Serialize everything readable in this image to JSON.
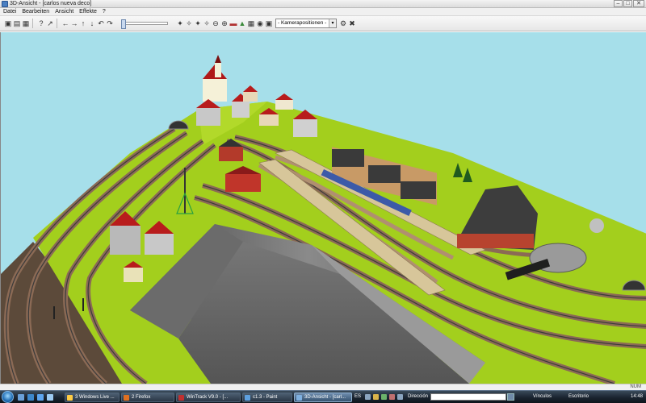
{
  "window": {
    "title": "3D-Ansicht - [carlos nueva deco]",
    "buttons": {
      "minimize": "–",
      "maximize": "□",
      "close": "✕"
    }
  },
  "menu": [
    "Datei",
    "Bearbeiten",
    "Ansicht",
    "Effekte",
    "?"
  ],
  "toolbar": {
    "icons": [
      {
        "name": "save-icon",
        "glyph": "▣"
      },
      {
        "name": "open-icon",
        "glyph": "▤"
      },
      {
        "name": "print-icon",
        "glyph": "▦"
      },
      {
        "name": "help-icon",
        "glyph": "?"
      },
      {
        "name": "context-help-icon",
        "glyph": "↗"
      },
      {
        "name": "arrow-left-icon",
        "glyph": "←"
      },
      {
        "name": "arrow-right-icon",
        "glyph": "→"
      },
      {
        "name": "arrow-up-icon",
        "glyph": "↑"
      },
      {
        "name": "arrow-down-icon",
        "glyph": "↓"
      },
      {
        "name": "rotate-left-icon",
        "glyph": "↶"
      },
      {
        "name": "rotate-right-icon",
        "glyph": "↷"
      },
      {
        "name": "tilt-1-icon",
        "glyph": "✦"
      },
      {
        "name": "tilt-2-icon",
        "glyph": "✧"
      },
      {
        "name": "tilt-3-icon",
        "glyph": "✦"
      },
      {
        "name": "tilt-4-icon",
        "glyph": "✧"
      },
      {
        "name": "zoom-out-icon",
        "glyph": "⊖"
      },
      {
        "name": "zoom-in-icon",
        "glyph": "⊕"
      },
      {
        "name": "train-icon",
        "glyph": "▬"
      },
      {
        "name": "landscape-icon",
        "glyph": "▲"
      },
      {
        "name": "grid-icon",
        "glyph": "▦"
      },
      {
        "name": "camera-icon",
        "glyph": "◉"
      },
      {
        "name": "snapshot-icon",
        "glyph": "▣"
      },
      {
        "name": "camera-pos-1-icon",
        "glyph": "①"
      },
      {
        "name": "camera-pos-2-icon",
        "glyph": "②"
      },
      {
        "name": "camera-pos-3-icon",
        "glyph": "③"
      },
      {
        "name": "camera-pos-4-icon",
        "glyph": "④"
      },
      {
        "name": "camera-settings-icon",
        "glyph": "⚙"
      },
      {
        "name": "camera-delete-icon",
        "glyph": "✖"
      }
    ],
    "camera_select": "- Kamerapositionen -",
    "camera_select_arrow": "▾"
  },
  "status": {
    "num": "NUM"
  },
  "taskbar": {
    "tasks": [
      {
        "name": "task-windows-live",
        "label": "3 Windows Live ..."
      },
      {
        "name": "task-firefox",
        "label": "2 Firefox"
      },
      {
        "name": "task-wintrack",
        "label": "WinTrack V9.0 - [..."
      },
      {
        "name": "task-paint",
        "label": "c1.3 - Paint"
      },
      {
        "name": "task-3d-ansicht",
        "label": "3D-Ansicht - [carl..."
      }
    ],
    "language": "ES",
    "address_label": "Dirección",
    "links": [
      "Vínculos",
      "Escritorio"
    ],
    "clock": "14:48"
  }
}
